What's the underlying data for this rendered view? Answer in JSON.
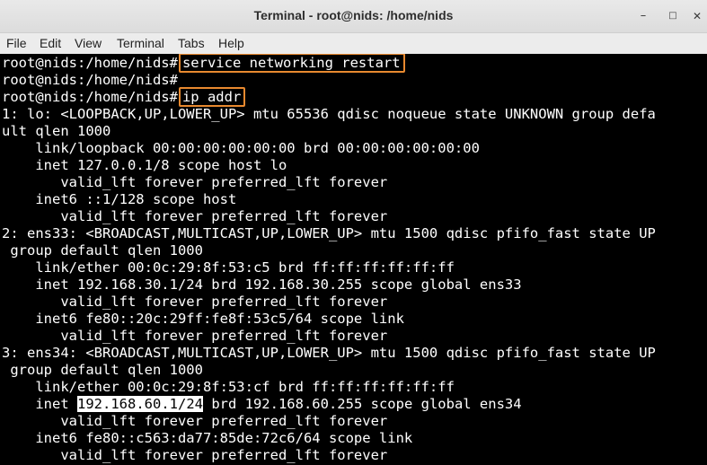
{
  "window": {
    "title": "Terminal - root@nids: /home/nids",
    "minimize_glyph": "–",
    "maximize_glyph": "□",
    "close_glyph": "✕"
  },
  "menubar": {
    "items": [
      "File",
      "Edit",
      "View",
      "Terminal",
      "Tabs",
      "Help"
    ]
  },
  "terminal": {
    "prompt": "root@nids:/home/nids#",
    "lines": [
      {
        "type": "cmd",
        "text": "service networking restart"
      },
      {
        "type": "prompt"
      },
      {
        "type": "cmd",
        "text": "ip addr"
      },
      {
        "type": "out",
        "text": "1: lo: <LOOPBACK,UP,LOWER_UP> mtu 65536 qdisc noqueue state UNKNOWN group defa"
      },
      {
        "type": "out",
        "text": "ult qlen 1000"
      },
      {
        "type": "out",
        "text": "    link/loopback 00:00:00:00:00:00 brd 00:00:00:00:00:00"
      },
      {
        "type": "out",
        "text": "    inet 127.0.0.1/8 scope host lo"
      },
      {
        "type": "out",
        "text": "       valid_lft forever preferred_lft forever"
      },
      {
        "type": "out",
        "text": "    inet6 ::1/128 scope host"
      },
      {
        "type": "out",
        "text": "       valid_lft forever preferred_lft forever"
      },
      {
        "type": "out",
        "text": "2: ens33: <BROADCAST,MULTICAST,UP,LOWER_UP> mtu 1500 qdisc pfifo_fast state UP"
      },
      {
        "type": "out",
        "text": " group default qlen 1000"
      },
      {
        "type": "out",
        "text": "    link/ether 00:0c:29:8f:53:c5 brd ff:ff:ff:ff:ff:ff"
      },
      {
        "type": "out",
        "text": "    inet 192.168.30.1/24 brd 192.168.30.255 scope global ens33"
      },
      {
        "type": "out",
        "text": "       valid_lft forever preferred_lft forever"
      },
      {
        "type": "out",
        "text": "    inet6 fe80::20c:29ff:fe8f:53c5/64 scope link"
      },
      {
        "type": "out",
        "text": "       valid_lft forever preferred_lft forever"
      },
      {
        "type": "out",
        "text": "3: ens34: <BROADCAST,MULTICAST,UP,LOWER_UP> mtu 1500 qdisc pfifo_fast state UP"
      },
      {
        "type": "out",
        "text": " group default qlen 1000"
      },
      {
        "type": "out",
        "text": "    link/ether 00:0c:29:8f:53:cf brd ff:ff:ff:ff:ff:ff"
      },
      {
        "type": "hl",
        "pre": "    inet ",
        "hl": "192.168.60.1/24",
        "post": " brd 192.168.60.255 scope global ens34"
      },
      {
        "type": "out",
        "text": "       valid_lft forever preferred_lft forever"
      },
      {
        "type": "out",
        "text": "    inet6 fe80::c563:da77:85de:72c6/64 scope link"
      },
      {
        "type": "out",
        "text": "       valid_lft forever preferred_lft forever"
      }
    ]
  },
  "colors": {
    "terminal_bg": "#000000",
    "terminal_fg": "#ffffff",
    "annotation_box": "#e8892f",
    "highlight_bg": "#ffffff"
  }
}
